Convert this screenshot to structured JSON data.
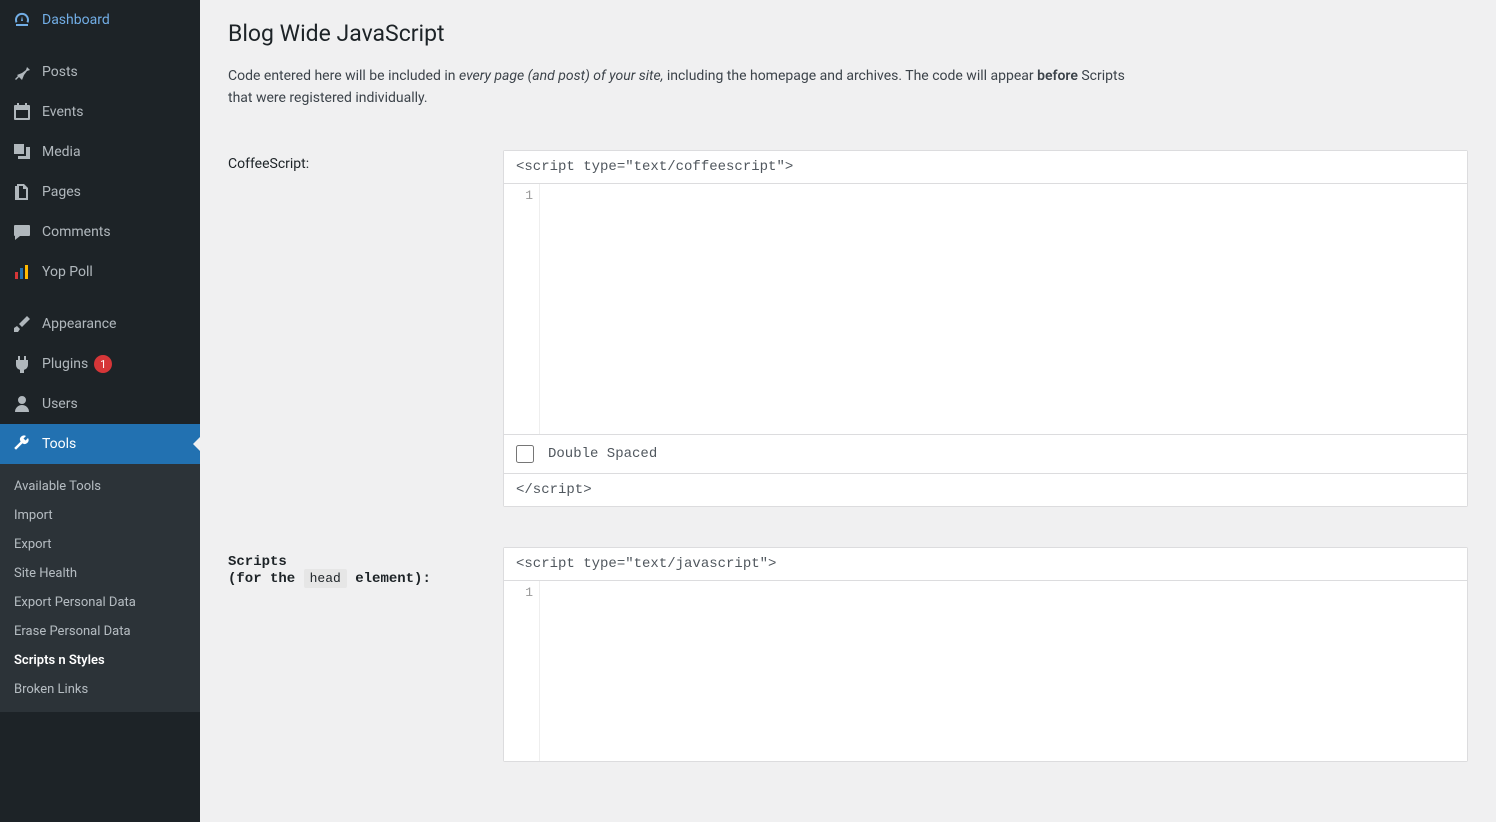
{
  "sidebar": {
    "items": [
      {
        "label": "Dashboard"
      },
      {
        "label": "Posts"
      },
      {
        "label": "Events"
      },
      {
        "label": "Media"
      },
      {
        "label": "Pages"
      },
      {
        "label": "Comments"
      },
      {
        "label": "Yop Poll"
      },
      {
        "label": "Appearance"
      },
      {
        "label": "Plugins",
        "badge": "1"
      },
      {
        "label": "Users"
      },
      {
        "label": "Tools"
      }
    ],
    "submenu": [
      {
        "label": "Available Tools"
      },
      {
        "label": "Import"
      },
      {
        "label": "Export"
      },
      {
        "label": "Site Health"
      },
      {
        "label": "Export Personal Data"
      },
      {
        "label": "Erase Personal Data"
      },
      {
        "label": "Scripts n Styles"
      },
      {
        "label": "Broken Links"
      }
    ]
  },
  "page": {
    "title": "Blog Wide JavaScript",
    "desc_pre": "Code entered here will be included in ",
    "desc_em": "every page (and post) of your site,",
    "desc_mid": " including the homepage and archives. The code will appear ",
    "desc_strong": "before",
    "desc_post": " Scripts that were registered individually."
  },
  "coffee": {
    "label": "CoffeeScript:",
    "open_tag": "<script type=\"text/coffeescript\">",
    "line_no": "1",
    "checkbox_label": "Double Spaced",
    "close_tag": "</script>"
  },
  "scripts": {
    "label_line1": "Scripts",
    "label_pre": "(for the ",
    "label_code": "head",
    "label_post": " element):",
    "open_tag": "<script type=\"text/javascript\">",
    "line_no": "1"
  }
}
